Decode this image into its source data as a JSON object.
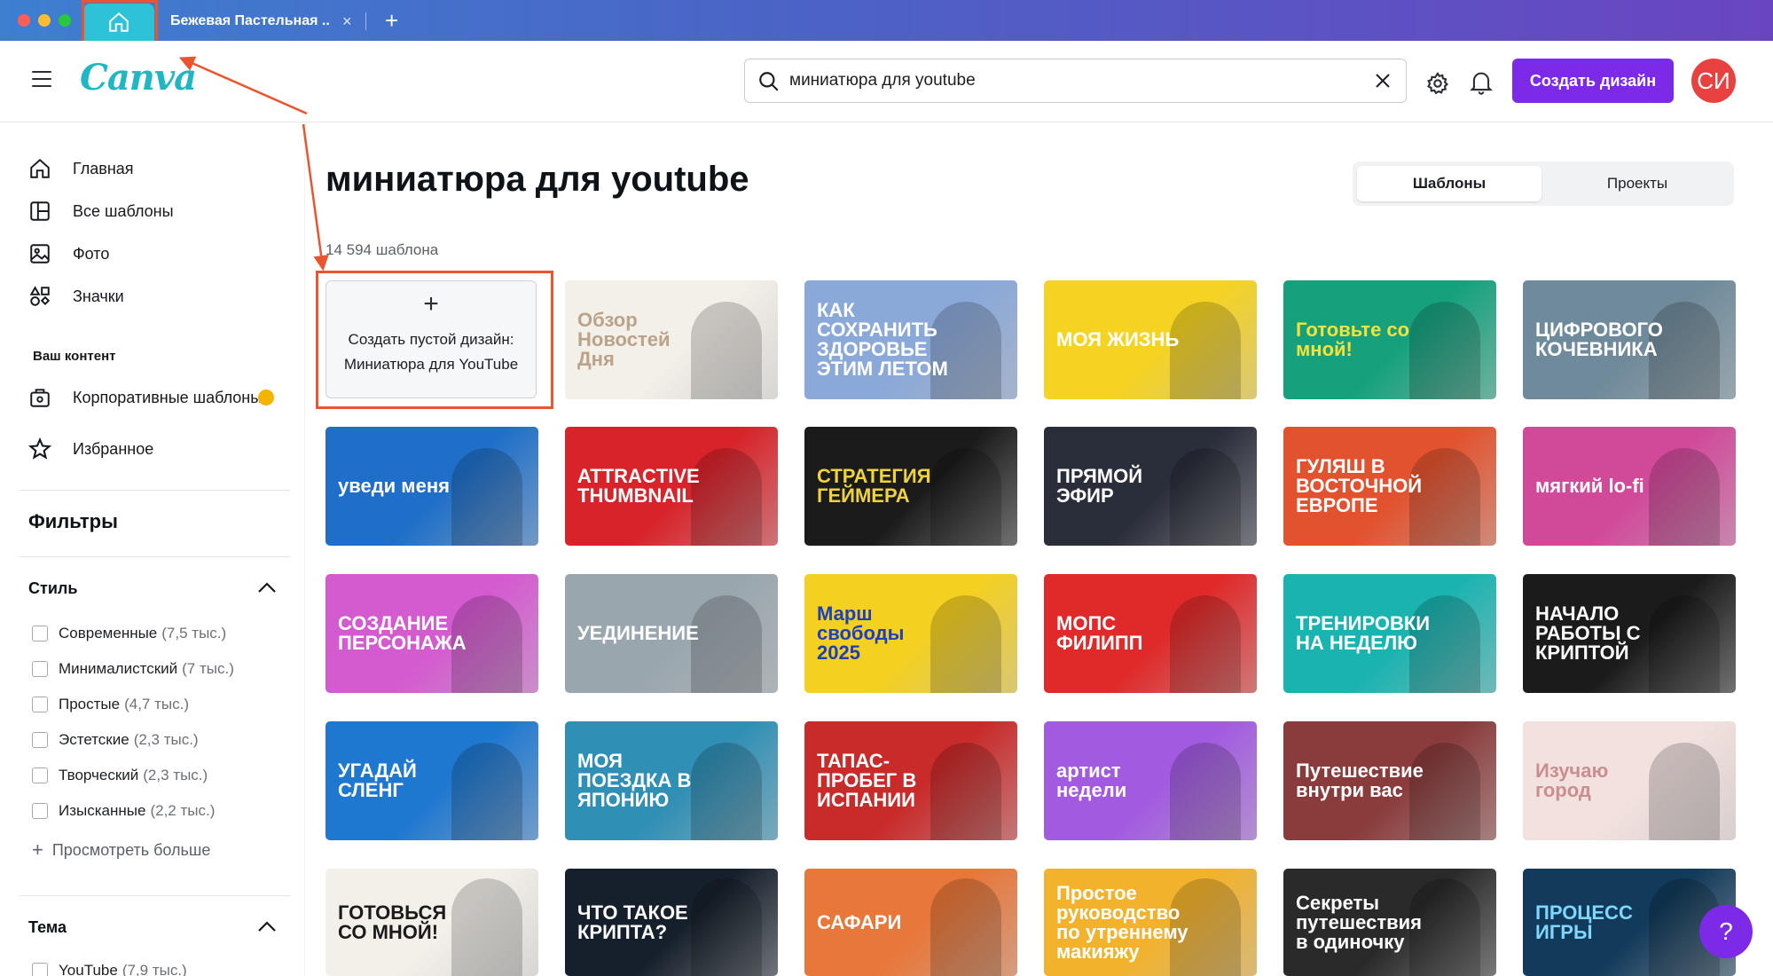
{
  "browser": {
    "tab_title": "Бежевая Пастельная ...",
    "tab_close": "×",
    "new_tab": "+"
  },
  "header": {
    "logo": "Canva",
    "search_value": "миниатюра для youtube",
    "create_button": "Создать дизайн",
    "avatar_initials": "СИ"
  },
  "sidebar": {
    "nav": [
      {
        "label": "Главная",
        "icon": "home-icon"
      },
      {
        "label": "Все шаблоны",
        "icon": "templates-icon"
      },
      {
        "label": "Фото",
        "icon": "photo-icon"
      },
      {
        "label": "Значки",
        "icon": "elements-icon"
      }
    ],
    "content_section": "Ваш контент",
    "content_items": [
      {
        "label": "Корпоративные шаблоны",
        "icon": "brand-kit-icon"
      },
      {
        "label": "Избранное",
        "icon": "star-icon"
      }
    ],
    "filters_title": "Фильтры",
    "style_title": "Стиль",
    "style_options": [
      {
        "label": "Современные",
        "count": "(7,5 тыс.)"
      },
      {
        "label": "Минималистский",
        "count": "(7 тыс.)"
      },
      {
        "label": "Простые",
        "count": "(4,7 тыс.)"
      },
      {
        "label": "Эстетские",
        "count": "(2,3 тыс.)"
      },
      {
        "label": "Творческий",
        "count": "(2,3 тыс.)"
      },
      {
        "label": "Изысканные",
        "count": "(2,2 тыс.)"
      }
    ],
    "see_more": "Просмотреть больше",
    "theme_title": "Тема",
    "theme_first": {
      "label": "YouTube",
      "count": "(7,9 тыс.)"
    }
  },
  "main": {
    "title": "миниатюра для youtube",
    "tabs": [
      {
        "label": "Шаблоны",
        "active": true
      },
      {
        "label": "Проекты",
        "active": false
      }
    ],
    "count": "14 594 шаблона",
    "create_blank_label": "Создать пустой дизайн: Миниатюра для YouTube",
    "templates": [
      {
        "text": "Обзор Новостей Дня",
        "bg": "#f3efe9",
        "fg": "#b9a48a"
      },
      {
        "text": "КАК СОХРАНИТЬ ЗДОРОВЬЕ ЭТИМ ЛЕТОМ",
        "bg": "#8aa8d8",
        "fg": "#ffffff"
      },
      {
        "text": "МОЯ ЖИЗНЬ",
        "bg": "#f5d322",
        "fg": "#ffffff"
      },
      {
        "text": "Готовьте со мной!",
        "bg": "#16a17c",
        "fg": "#f4e23a"
      },
      {
        "text": "ЦИФРОВОГО КОЧЕВНИКА",
        "bg": "#6f8a9a",
        "fg": "#ffffff"
      },
      {
        "text": "уведи меня",
        "bg": "#1f6fc8",
        "fg": "#ffffff"
      },
      {
        "text": "ATTRACTIVE THUMBNAIL",
        "bg": "#d8232a",
        "fg": "#ffffff"
      },
      {
        "text": "СТРАТЕГИЯ ГЕЙМЕРА",
        "bg": "#1b1b1b",
        "fg": "#f0d33a"
      },
      {
        "text": "ПРЯМОЙ ЭФИР",
        "bg": "#2a2d3a",
        "fg": "#ffffff"
      },
      {
        "text": "ГУЛЯШ В ВОСТОЧНОЙ ЕВРОПЕ",
        "bg": "#e2522e",
        "fg": "#ffffff"
      },
      {
        "text": "мягкий lo-fi",
        "bg": "#d14a9a",
        "fg": "#ffffff"
      },
      {
        "text": "СОЗДАНИЕ ПЕРСОНАЖА",
        "bg": "#d45ad0",
        "fg": "#ffffff"
      },
      {
        "text": "УЕДИНЕНИЕ",
        "bg": "#9aa6ae",
        "fg": "#ffffff"
      },
      {
        "text": "Марш свободы 2025",
        "bg": "#f4d021",
        "fg": "#1d3fbf"
      },
      {
        "text": "МОПС ФИЛИПП",
        "bg": "#e02a2a",
        "fg": "#ffffff"
      },
      {
        "text": "ТРЕНИРОВКИ НА НЕДЕЛЮ",
        "bg": "#19b3b0",
        "fg": "#ffffff"
      },
      {
        "text": "НАЧАЛО РАБОТЫ С КРИПТОЙ",
        "bg": "#1b1b1b",
        "fg": "#ffffff"
      },
      {
        "text": "УГАДАЙ СЛЕНГ",
        "bg": "#1f78d0",
        "fg": "#ffffff"
      },
      {
        "text": "МОЯ ПОЕЗДКА В ЯПОНИЮ",
        "bg": "#2f8fb5",
        "fg": "#ffffff"
      },
      {
        "text": "ТАПАС-ПРОБЕГ В ИСПАНИИ",
        "bg": "#c92a2a",
        "fg": "#ffffff"
      },
      {
        "text": "артист недели",
        "bg": "#a25be0",
        "fg": "#ffffff"
      },
      {
        "text": "Путешествие внутри вас",
        "bg": "#8a3b3b",
        "fg": "#ffffff"
      },
      {
        "text": "Изучаю город",
        "bg": "#f2e1df",
        "fg": "#c98f8f"
      },
      {
        "text": "ГОТОВЬСЯ СО МНОЙ!",
        "bg": "#f3f0ea",
        "fg": "#1b1b1b"
      },
      {
        "text": "ЧТО ТАКОЕ КРИПТА?",
        "bg": "#16202c",
        "fg": "#ffffff"
      },
      {
        "text": "САФАРИ",
        "bg": "#e8773a",
        "fg": "#ffffff"
      },
      {
        "text": "Простое руководство по утреннему макияжу",
        "bg": "#f2b22c",
        "fg": "#ffffff"
      },
      {
        "text": "Секреты путешествия в одиночку",
        "bg": "#2a2a2a",
        "fg": "#ffffff"
      },
      {
        "text": "ПРОЦЕСС ИГРЫ",
        "bg": "#123a5a",
        "fg": "#7fd6ff"
      }
    ]
  },
  "help_button": "?",
  "colors": {
    "accent": "#7d2ae8",
    "annotation": "#e8552e",
    "logo": "#1fb7c4",
    "avatar": "#e8413f"
  }
}
